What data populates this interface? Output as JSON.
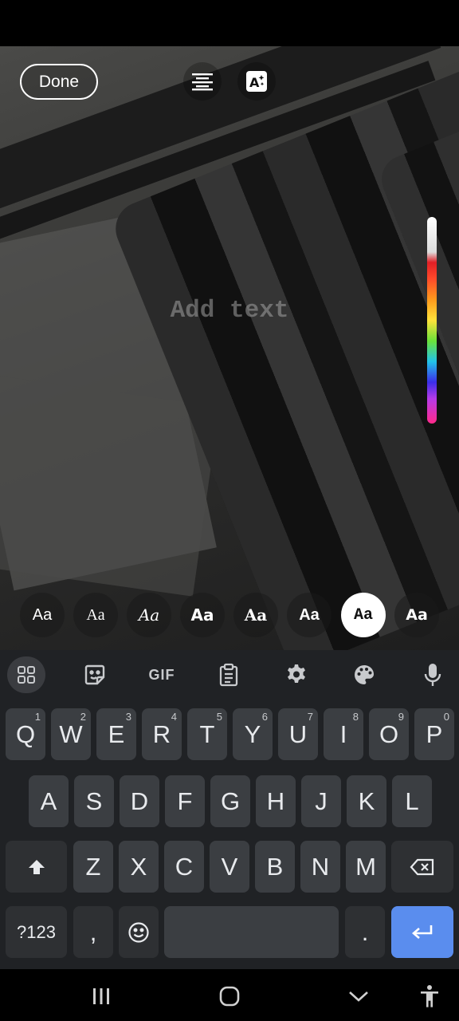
{
  "editor": {
    "done_label": "Done",
    "placeholder": "Add text",
    "align_icon": "align-center-icon",
    "effect_icon": "text-effect-icon"
  },
  "font_options": [
    {
      "label": "Aa",
      "selected": false
    },
    {
      "label": "Aa",
      "selected": false
    },
    {
      "label": "Aa",
      "selected": false
    },
    {
      "label": "Aa",
      "selected": false
    },
    {
      "label": "Aa",
      "selected": false
    },
    {
      "label": "Aa",
      "selected": false
    },
    {
      "label": "Aa",
      "selected": true
    },
    {
      "label": "Aa",
      "selected": false
    }
  ],
  "keyboard": {
    "toolbar": {
      "gif_label": "GIF",
      "icons": [
        "apps-grid-icon",
        "sticker-icon",
        "gif-icon",
        "clipboard-icon",
        "settings-gear-icon",
        "palette-icon",
        "microphone-icon"
      ]
    },
    "row1": [
      {
        "key": "Q",
        "hint": "1"
      },
      {
        "key": "W",
        "hint": "2"
      },
      {
        "key": "E",
        "hint": "3"
      },
      {
        "key": "R",
        "hint": "4"
      },
      {
        "key": "T",
        "hint": "5"
      },
      {
        "key": "Y",
        "hint": "6"
      },
      {
        "key": "U",
        "hint": "7"
      },
      {
        "key": "I",
        "hint": "8"
      },
      {
        "key": "O",
        "hint": "9"
      },
      {
        "key": "P",
        "hint": "0"
      }
    ],
    "row2": [
      "A",
      "S",
      "D",
      "F",
      "G",
      "H",
      "J",
      "K",
      "L"
    ],
    "row3": [
      "Z",
      "X",
      "C",
      "V",
      "B",
      "N",
      "M"
    ],
    "symbols_label": "?123",
    "comma_label": ",",
    "period_label": ".",
    "shift_icon": "shift-icon",
    "backspace_icon": "backspace-icon",
    "emoji_icon": "emoji-icon",
    "enter_icon": "enter-icon"
  },
  "navbar": {
    "icons": [
      "recent-apps-icon",
      "home-icon",
      "back-icon",
      "accessibility-icon"
    ]
  },
  "colors": {
    "enter_key": "#5a8dee",
    "keyboard_bg": "#202225",
    "key_bg": "#3b3e42"
  }
}
